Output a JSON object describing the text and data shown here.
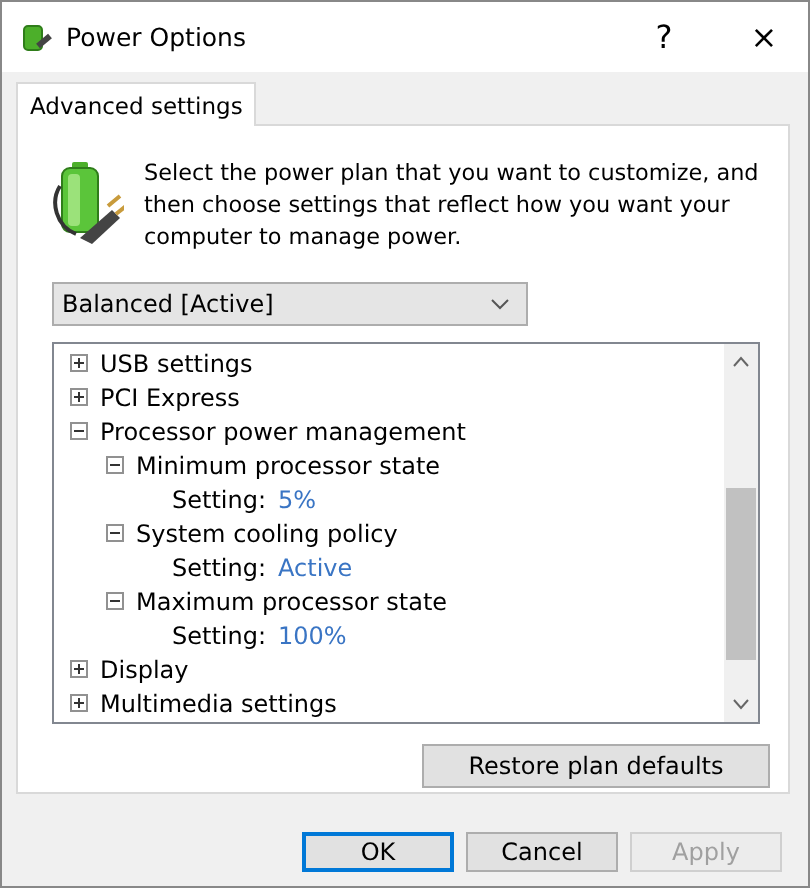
{
  "window": {
    "title": "Power Options",
    "help_glyph": "?",
    "close_glyph": "×"
  },
  "tabs": [
    {
      "label": "Advanced settings",
      "selected": true
    }
  ],
  "intro": "Select the power plan that you want to customize, and then choose settings that reflect how you want your computer to manage power.",
  "plan_select": {
    "value": "Balanced [Active]"
  },
  "tree": [
    {
      "label": "USB settings",
      "expanded": false
    },
    {
      "label": "PCI Express",
      "expanded": false
    },
    {
      "label": "Processor power management",
      "expanded": true,
      "children": [
        {
          "label": "Minimum processor state",
          "expanded": true,
          "setting": {
            "label": "Setting:",
            "value": "5%"
          }
        },
        {
          "label": "System cooling policy",
          "expanded": true,
          "setting": {
            "label": "Setting:",
            "value": "Active"
          }
        },
        {
          "label": "Maximum processor state",
          "expanded": true,
          "setting": {
            "label": "Setting:",
            "value": "100%"
          }
        }
      ]
    },
    {
      "label": "Display",
      "expanded": false
    },
    {
      "label": "Multimedia settings",
      "expanded": false
    }
  ],
  "restore_button": "Restore plan defaults",
  "buttons": [
    {
      "label": "OK",
      "default": true,
      "disabled": false
    },
    {
      "label": "Cancel",
      "default": false,
      "disabled": false
    },
    {
      "label": "Apply",
      "default": false,
      "disabled": true
    }
  ]
}
